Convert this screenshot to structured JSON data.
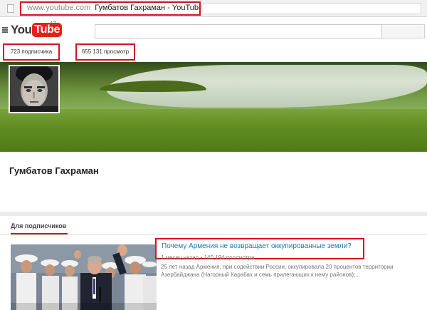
{
  "browser": {
    "url_host": "www.youtube.com",
    "page_title": "Гумбатов Гахраман - YouTube"
  },
  "header": {
    "logo_you": "You",
    "logo_tube": "Tube",
    "region": "AZ",
    "search_placeholder": ""
  },
  "stats": {
    "subscribers": "723 подписчика",
    "views": "655 131 просмотр"
  },
  "channel": {
    "name": "Гумбатов Гахраман"
  },
  "section": {
    "tab_label": "Для подписчиков"
  },
  "video": {
    "title": "Почему Армения не возвращает оккупированные земли?",
    "meta": "1 месяц назад • 140 194 просмотра",
    "description": "25 лет назад Армения, при содействии России, оккупировала 20 процентов территории Азербайджана (Нагорный Карабах и семь прилегающих к нему районов):..."
  },
  "colors": {
    "highlight_border": "#d4131e",
    "link_blue": "#167ac6",
    "brand_red": "#e62117"
  },
  "icons": [
    "page-icon",
    "hamburger-menu-icon",
    "youtube-logo",
    "search-icon"
  ]
}
